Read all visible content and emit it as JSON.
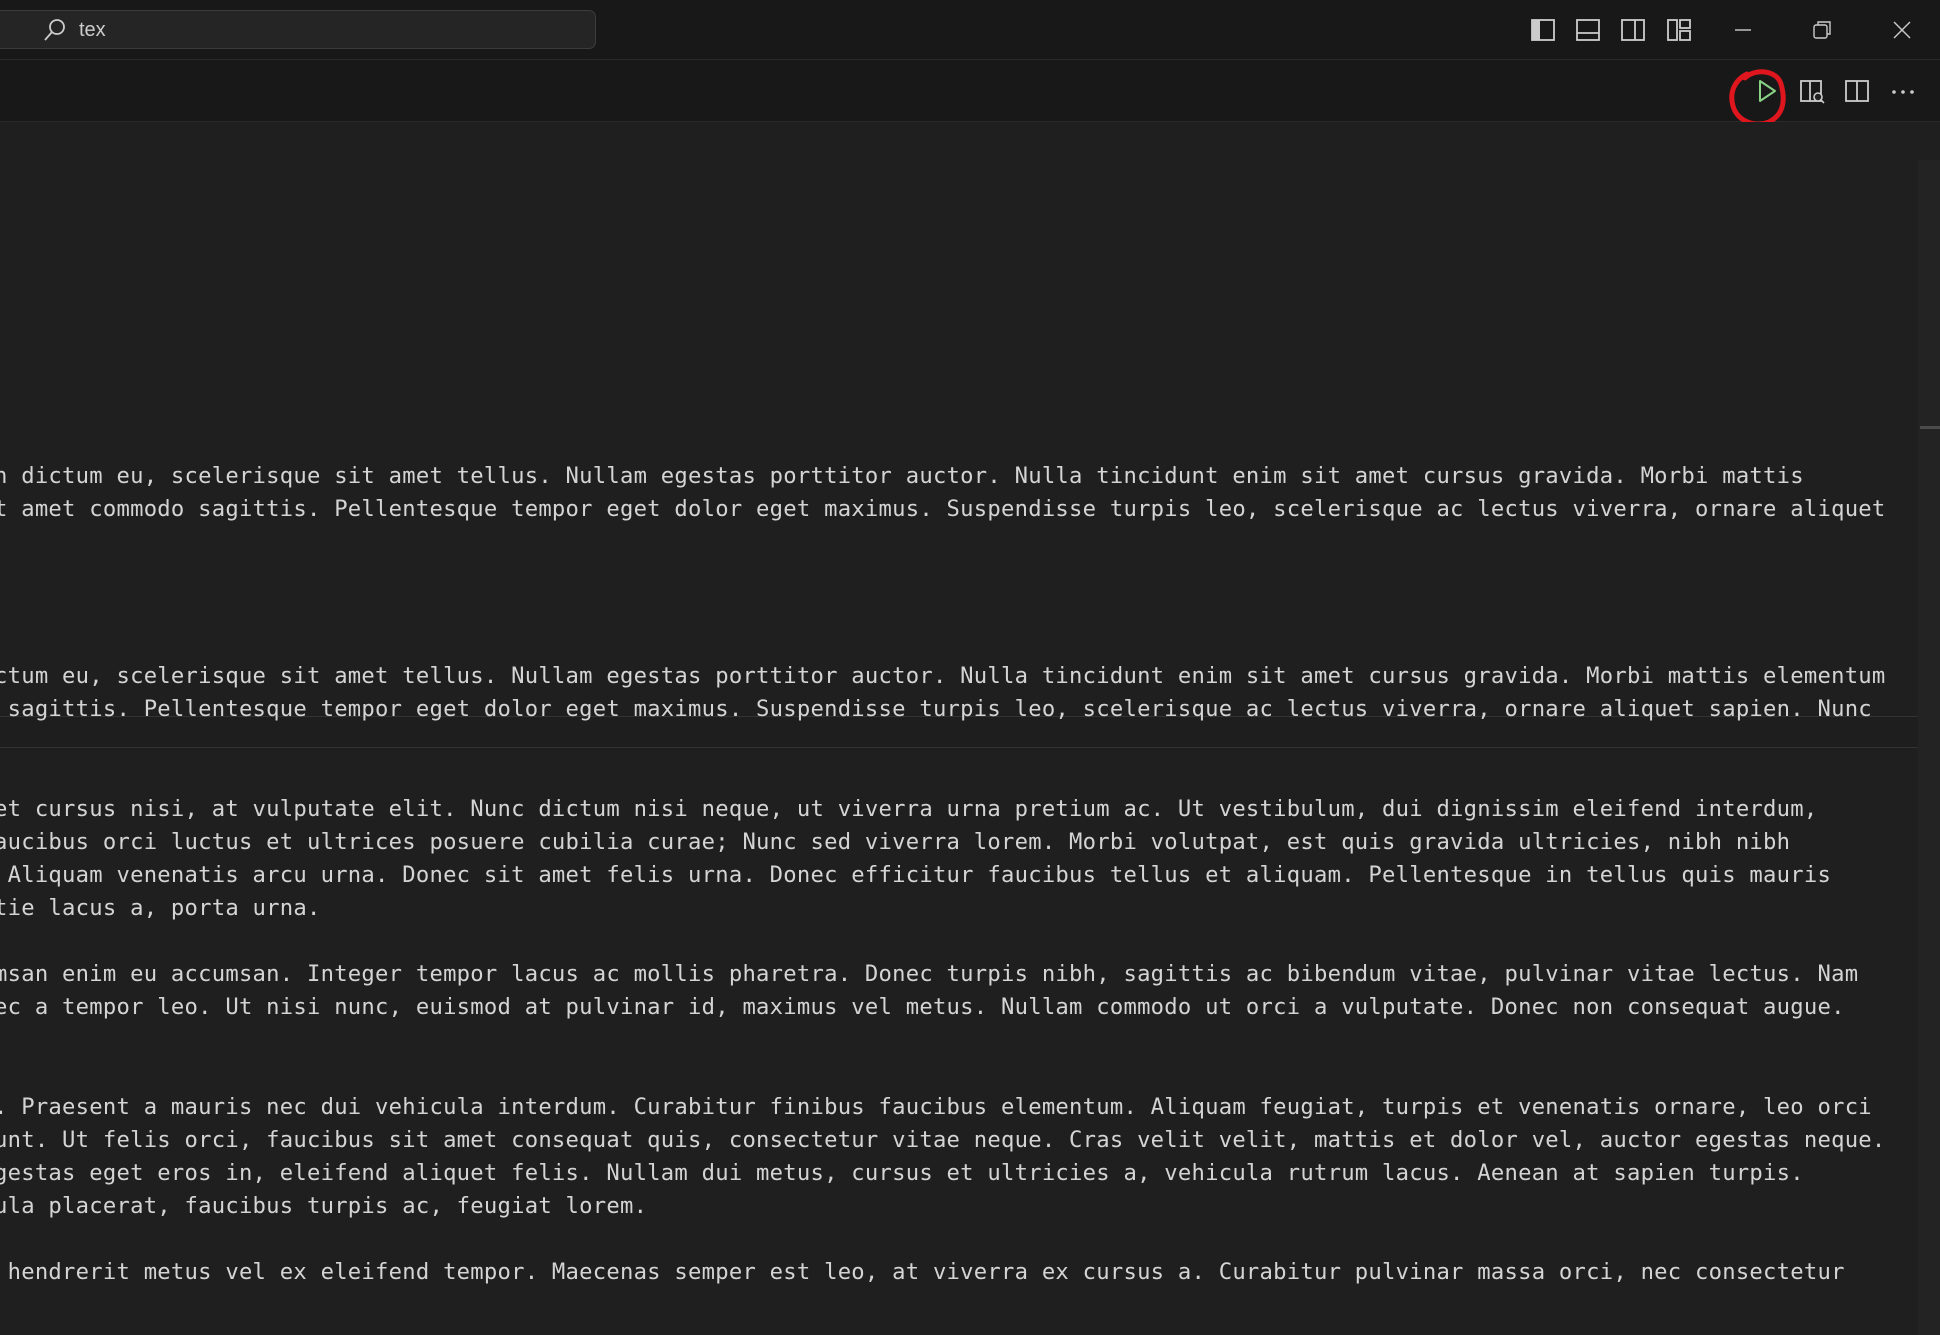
{
  "search": {
    "value": "tex"
  },
  "window_controls": {
    "toggle_primary_sidebar": "toggle-primary-sidebar",
    "toggle_panel": "toggle-panel",
    "toggle_secondary_sidebar": "toggle-secondary-sidebar",
    "customize_layout": "customize-layout",
    "minimize": "minimize",
    "restore": "restore",
    "close": "close"
  },
  "editor_toolbar": {
    "run": "play-icon",
    "open_preview": "preview-icon",
    "split_editor": "split-editor-icon",
    "more_actions": "ellipsis-icon",
    "annotation_color": "#e0161e"
  },
  "colors": {
    "background": "#1f1f1f",
    "titlebar": "#181818",
    "text": "#d4d4d4"
  },
  "editor": {
    "lines": [
      "n dictum eu, scelerisque sit amet tellus. Nullam egestas porttitor auctor. Nulla tincidunt enim sit amet cursus gravida. Morbi mattis",
      "t amet commodo sagittis. Pellentesque tempor eget dolor eget maximus. Suspendisse turpis leo, scelerisque ac lectus viverra, ornare aliquet",
      "ctum eu, scelerisque sit amet tellus. Nullam egestas porttitor auctor. Nulla tincidunt enim sit amet cursus gravida. Morbi mattis elementum",
      " sagittis. Pellentesque tempor eget dolor eget maximus. Suspendisse turpis leo, scelerisque ac lectus viverra, ornare aliquet sapien. Nunc",
      "et cursus nisi, at vulputate elit. Nunc dictum nisi neque, ut viverra urna pretium ac. Ut vestibulum, dui dignissim eleifend interdum,",
      "aucibus orci luctus et ultrices posuere cubilia curae; Nunc sed viverra lorem. Morbi volutpat, est quis gravida ultricies, nibh nibh",
      " Aliquam venenatis arcu urna. Donec sit amet felis urna. Donec efficitur faucibus tellus et aliquam. Pellentesque in tellus quis mauris",
      "tie lacus a, porta urna.",
      "msan enim eu accumsan. Integer tempor lacus ac mollis pharetra. Donec turpis nibh, sagittis ac bibendum vitae, pulvinar vitae lectus. Nam",
      "ec a tempor leo. Ut nisi nunc, euismod at pulvinar id, maximus vel metus. Nullam commodo ut orci a vulputate. Donec non consequat augue.",
      ". Praesent a mauris nec dui vehicula interdum. Curabitur finibus faucibus elementum. Aliquam feugiat, turpis et venenatis ornare, leo orci",
      "unt. Ut felis orci, faucibus sit amet consequat quis, consectetur vitae neque. Cras velit velit, mattis et dolor vel, auctor egestas neque.",
      "gestas eget eros in, eleifend aliquet felis. Nullam dui metus, cursus et ultricies a, vehicula rutrum lacus. Aenean at sapien turpis.",
      "ula placerat, faucibus turpis ac, feugiat lorem.",
      " hendrerit metus vel ex eleifend tempor. Maecenas semper est leo, at viverra ex cursus a. Curabitur pulvinar massa orci, nec consectetur"
    ]
  }
}
